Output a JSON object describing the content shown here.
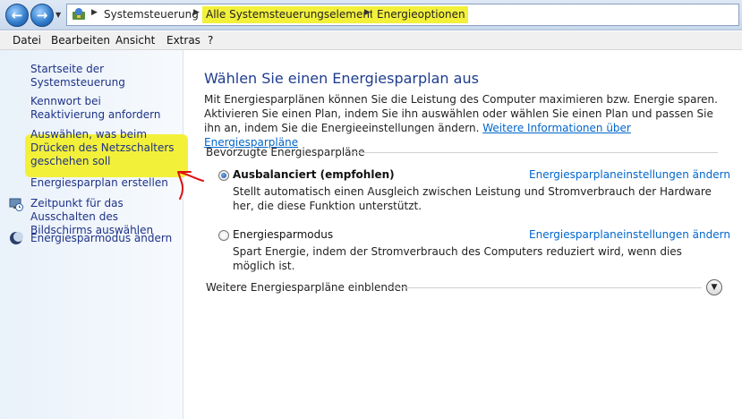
{
  "address": {
    "breadcrumbs": [
      "Systemsteuerung",
      "Alle Systemsteuerungselemente",
      "Energieoptionen"
    ],
    "back_icon": "back-arrow-icon",
    "forward_icon": "forward-arrow-icon"
  },
  "menu": {
    "items": [
      "Datei",
      "Bearbeiten",
      "Ansicht",
      "Extras",
      "?"
    ]
  },
  "sidebar": {
    "home": "Startseite der Systemsteuerung",
    "links": [
      {
        "label": "Kennwort bei Reaktivierung anfordern"
      },
      {
        "label": "Auswählen, was beim Drücken des Netzschalters geschehen soll"
      },
      {
        "label": "Energiesparplan erstellen"
      },
      {
        "label": "Zeitpunkt für das Ausschalten des Bildschirms auswählen",
        "icon": "monitor-clock-icon"
      },
      {
        "label": "Energiesparmodus ändern",
        "icon": "moon-icon"
      }
    ],
    "highlight_color": "#f3f03a",
    "annotation_color": "#e01010"
  },
  "main": {
    "title": "Wählen Sie einen Energiesparplan aus",
    "description": "Mit Energiesparplänen können Sie die Leistung des Computer maximieren bzw. Energie sparen. Aktivieren Sie einen Plan, indem Sie ihn auswählen oder wählen Sie einen Plan und passen Sie ihn an, indem Sie die Energieeinstellungen ändern.",
    "info_link": "Weitere Informationen über Energiesparpläne",
    "section_label": "Bevorzugte Energiesparpläne",
    "plans": [
      {
        "name": "Ausbalanciert (empfohlen)",
        "selected": true,
        "description": "Stellt automatisch einen Ausgleich zwischen Leistung und Stromverbrauch der Hardware her, die diese Funktion unterstützt.",
        "settings_link": "Energiesparplaneinstellungen ändern"
      },
      {
        "name": "Energiesparmodus",
        "selected": false,
        "description": "Spart Energie, indem der Stromverbrauch des Computers reduziert wird, wenn dies möglich ist.",
        "settings_link": "Energiesparplaneinstellungen ändern"
      }
    ],
    "more_plans_label": "Weitere Energiesparpläne einblenden",
    "link_color": "#0066cc",
    "title_color": "#1e3d8f"
  }
}
